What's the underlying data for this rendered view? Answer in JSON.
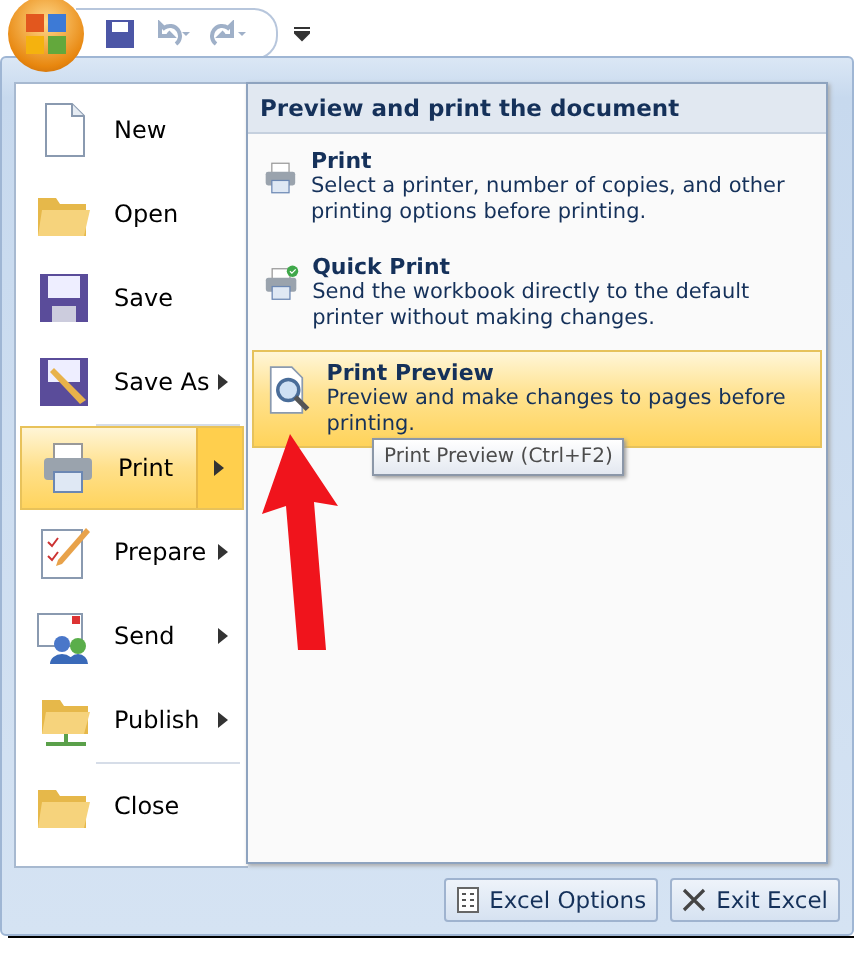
{
  "menu": {
    "items": [
      {
        "label": "New",
        "submenu": false,
        "selected": false
      },
      {
        "label": "Open",
        "submenu": false,
        "selected": false
      },
      {
        "label": "Save",
        "submenu": false,
        "selected": false
      },
      {
        "label": "Save As",
        "submenu": true,
        "selected": false
      },
      {
        "label": "Print",
        "submenu": true,
        "selected": true
      },
      {
        "label": "Prepare",
        "submenu": true,
        "selected": false
      },
      {
        "label": "Send",
        "submenu": true,
        "selected": false
      },
      {
        "label": "Publish",
        "submenu": true,
        "selected": false
      },
      {
        "label": "Close",
        "submenu": false,
        "selected": false
      }
    ]
  },
  "panel": {
    "title": "Preview and print the document",
    "items": [
      {
        "title": "Print",
        "description": "Select a printer, number of copies, and other printing options before printing.",
        "selected": false
      },
      {
        "title": "Quick Print",
        "description": "Send the workbook directly to the default printer without making changes.",
        "selected": false
      },
      {
        "title": "Print Preview",
        "description": "Preview and make changes to pages before printing.",
        "selected": true
      }
    ]
  },
  "tooltip": "Print Preview (Ctrl+F2)",
  "buttons": [
    {
      "label": "Excel Options"
    },
    {
      "label": "Exit Excel"
    }
  ]
}
